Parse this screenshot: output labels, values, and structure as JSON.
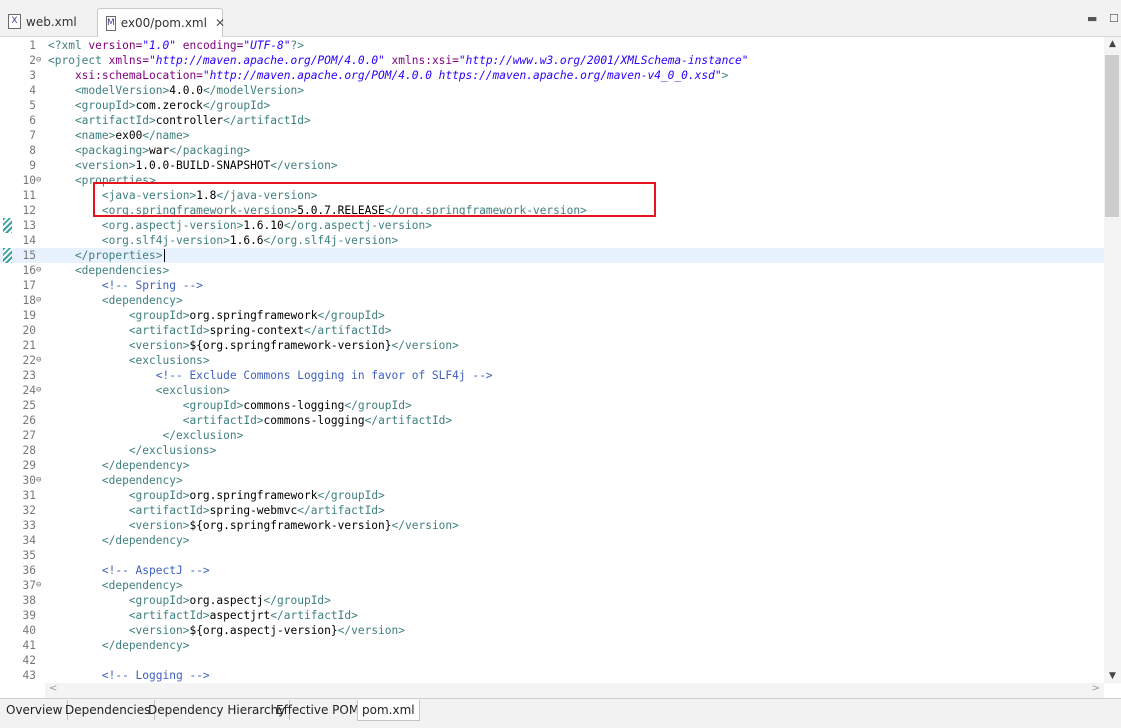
{
  "tabs": [
    {
      "label": "web.xml"
    },
    {
      "label": "ex00/pom.xml"
    }
  ],
  "bottom_tabs": [
    "Overview",
    "Dependencies",
    "Dependency Hierarchy",
    "Effective POM",
    "pom.xml"
  ],
  "lines": [
    {
      "n": "1",
      "fold": "",
      "s": [
        [
          "pi",
          "<?xml "
        ],
        [
          "attr",
          "version="
        ],
        [
          "val",
          "\"1.0\""
        ],
        [
          "attr",
          " encoding="
        ],
        [
          "val",
          "\"UTF-8\""
        ],
        [
          "pi",
          "?>"
        ]
      ]
    },
    {
      "n": "2",
      "fold": "⊖",
      "s": [
        [
          "tag",
          "<project "
        ],
        [
          "attr",
          "xmlns="
        ],
        [
          "val",
          "\"http://maven.apache.org/POM/4.0.0\""
        ],
        [
          "attr",
          " xmlns:xsi="
        ],
        [
          "val",
          "\"http://www.w3.org/2001/XMLSchema-instance\""
        ]
      ]
    },
    {
      "n": "3",
      "fold": "",
      "s": [
        [
          "attr",
          "    xsi:schemaLocation="
        ],
        [
          "val",
          "\"http://maven.apache.org/POM/4.0.0 https://maven.apache.org/maven-v4_0_0.xsd\""
        ],
        [
          "tag",
          ">"
        ]
      ]
    },
    {
      "n": "4",
      "fold": "",
      "s": [
        [
          "tag",
          "    <modelVersion>"
        ],
        [
          "text",
          "4.0.0"
        ],
        [
          "tag",
          "</modelVersion>"
        ]
      ]
    },
    {
      "n": "5",
      "fold": "",
      "s": [
        [
          "tag",
          "    <groupId>"
        ],
        [
          "text",
          "com.zerock"
        ],
        [
          "tag",
          "</groupId>"
        ]
      ]
    },
    {
      "n": "6",
      "fold": "",
      "s": [
        [
          "tag",
          "    <artifactId>"
        ],
        [
          "text",
          "controller"
        ],
        [
          "tag",
          "</artifactId>"
        ]
      ]
    },
    {
      "n": "7",
      "fold": "",
      "s": [
        [
          "tag",
          "    <name>"
        ],
        [
          "text",
          "ex00"
        ],
        [
          "tag",
          "</name>"
        ]
      ]
    },
    {
      "n": "8",
      "fold": "",
      "s": [
        [
          "tag",
          "    <packaging>"
        ],
        [
          "text",
          "war"
        ],
        [
          "tag",
          "</packaging>"
        ]
      ]
    },
    {
      "n": "9",
      "fold": "",
      "s": [
        [
          "tag",
          "    <version>"
        ],
        [
          "text",
          "1.0.0-BUILD-SNAPSHOT"
        ],
        [
          "tag",
          "</version>"
        ]
      ]
    },
    {
      "n": "10",
      "fold": "⊖",
      "s": [
        [
          "tag",
          "    <properties>"
        ]
      ]
    },
    {
      "n": "11",
      "fold": "",
      "s": [
        [
          "tag",
          "        <java-version>"
        ],
        [
          "text",
          "1.8"
        ],
        [
          "tag",
          "</java-version>"
        ]
      ]
    },
    {
      "n": "12",
      "fold": "",
      "s": [
        [
          "tag",
          "        <org.springframework-version>"
        ],
        [
          "text",
          "5.0.7.RELEASE"
        ],
        [
          "tag",
          "</org.springframework-version>"
        ]
      ]
    },
    {
      "n": "13",
      "fold": "",
      "s": [
        [
          "tag",
          "        <org.aspectj-version>"
        ],
        [
          "text",
          "1.6.10"
        ],
        [
          "tag",
          "</org.aspectj-version>"
        ]
      ]
    },
    {
      "n": "14",
      "fold": "",
      "s": [
        [
          "tag",
          "        <org.slf4j-version>"
        ],
        [
          "text",
          "1.6.6"
        ],
        [
          "tag",
          "</org.slf4j-version>"
        ]
      ]
    },
    {
      "n": "15",
      "fold": "",
      "s": [
        [
          "tag",
          "    </properties>"
        ]
      ]
    },
    {
      "n": "16",
      "fold": "⊖",
      "s": [
        [
          "tag",
          "    <dependencies>"
        ]
      ]
    },
    {
      "n": "17",
      "fold": "",
      "s": [
        [
          "com",
          "        <!-- Spring -->"
        ]
      ]
    },
    {
      "n": "18",
      "fold": "⊖",
      "s": [
        [
          "tag",
          "        <dependency>"
        ]
      ]
    },
    {
      "n": "19",
      "fold": "",
      "s": [
        [
          "tag",
          "            <groupId>"
        ],
        [
          "text",
          "org.springframework"
        ],
        [
          "tag",
          "</groupId>"
        ]
      ]
    },
    {
      "n": "20",
      "fold": "",
      "s": [
        [
          "tag",
          "            <artifactId>"
        ],
        [
          "text",
          "spring-context"
        ],
        [
          "tag",
          "</artifactId>"
        ]
      ]
    },
    {
      "n": "21",
      "fold": "",
      "s": [
        [
          "tag",
          "            <version>"
        ],
        [
          "text",
          "${org.springframework-version}"
        ],
        [
          "tag",
          "</version>"
        ]
      ]
    },
    {
      "n": "22",
      "fold": "⊖",
      "s": [
        [
          "tag",
          "            <exclusions>"
        ]
      ]
    },
    {
      "n": "23",
      "fold": "",
      "s": [
        [
          "com",
          "                <!-- Exclude Commons Logging in favor of SLF4j -->"
        ]
      ]
    },
    {
      "n": "24",
      "fold": "⊖",
      "s": [
        [
          "tag",
          "                <exclusion>"
        ]
      ]
    },
    {
      "n": "25",
      "fold": "",
      "s": [
        [
          "tag",
          "                    <groupId>"
        ],
        [
          "text",
          "commons-logging"
        ],
        [
          "tag",
          "</groupId>"
        ]
      ]
    },
    {
      "n": "26",
      "fold": "",
      "s": [
        [
          "tag",
          "                    <artifactId>"
        ],
        [
          "text",
          "commons-logging"
        ],
        [
          "tag",
          "</artifactId>"
        ]
      ]
    },
    {
      "n": "27",
      "fold": "",
      "s": [
        [
          "tag",
          "                 </exclusion>"
        ]
      ]
    },
    {
      "n": "28",
      "fold": "",
      "s": [
        [
          "tag",
          "            </exclusions>"
        ]
      ]
    },
    {
      "n": "29",
      "fold": "",
      "s": [
        [
          "tag",
          "        </dependency>"
        ]
      ]
    },
    {
      "n": "30",
      "fold": "⊖",
      "s": [
        [
          "tag",
          "        <dependency>"
        ]
      ]
    },
    {
      "n": "31",
      "fold": "",
      "s": [
        [
          "tag",
          "            <groupId>"
        ],
        [
          "text",
          "org.springframework"
        ],
        [
          "tag",
          "</groupId>"
        ]
      ]
    },
    {
      "n": "32",
      "fold": "",
      "s": [
        [
          "tag",
          "            <artifactId>"
        ],
        [
          "text",
          "spring-webmvc"
        ],
        [
          "tag",
          "</artifactId>"
        ]
      ]
    },
    {
      "n": "33",
      "fold": "",
      "s": [
        [
          "tag",
          "            <version>"
        ],
        [
          "text",
          "${org.springframework-version}"
        ],
        [
          "tag",
          "</version>"
        ]
      ]
    },
    {
      "n": "34",
      "fold": "",
      "s": [
        [
          "tag",
          "        </dependency>"
        ]
      ]
    },
    {
      "n": "35",
      "fold": "",
      "s": []
    },
    {
      "n": "36",
      "fold": "",
      "s": [
        [
          "com",
          "        <!-- AspectJ -->"
        ]
      ]
    },
    {
      "n": "37",
      "fold": "⊖",
      "s": [
        [
          "tag",
          "        <dependency>"
        ]
      ]
    },
    {
      "n": "38",
      "fold": "",
      "s": [
        [
          "tag",
          "            <groupId>"
        ],
        [
          "text",
          "org.aspectj"
        ],
        [
          "tag",
          "</groupId>"
        ]
      ]
    },
    {
      "n": "39",
      "fold": "",
      "s": [
        [
          "tag",
          "            <artifactId>"
        ],
        [
          "text",
          "aspectjrt"
        ],
        [
          "tag",
          "</artifactId>"
        ]
      ]
    },
    {
      "n": "40",
      "fold": "",
      "s": [
        [
          "tag",
          "            <version>"
        ],
        [
          "text",
          "${org.aspectj-version}"
        ],
        [
          "tag",
          "</version>"
        ]
      ]
    },
    {
      "n": "41",
      "fold": "",
      "s": [
        [
          "tag",
          "        </dependency>"
        ]
      ]
    },
    {
      "n": "42",
      "fold": "",
      "s": []
    },
    {
      "n": "43",
      "fold": "",
      "s": [
        [
          "com",
          "        <!-- Logging -->"
        ]
      ]
    }
  ]
}
